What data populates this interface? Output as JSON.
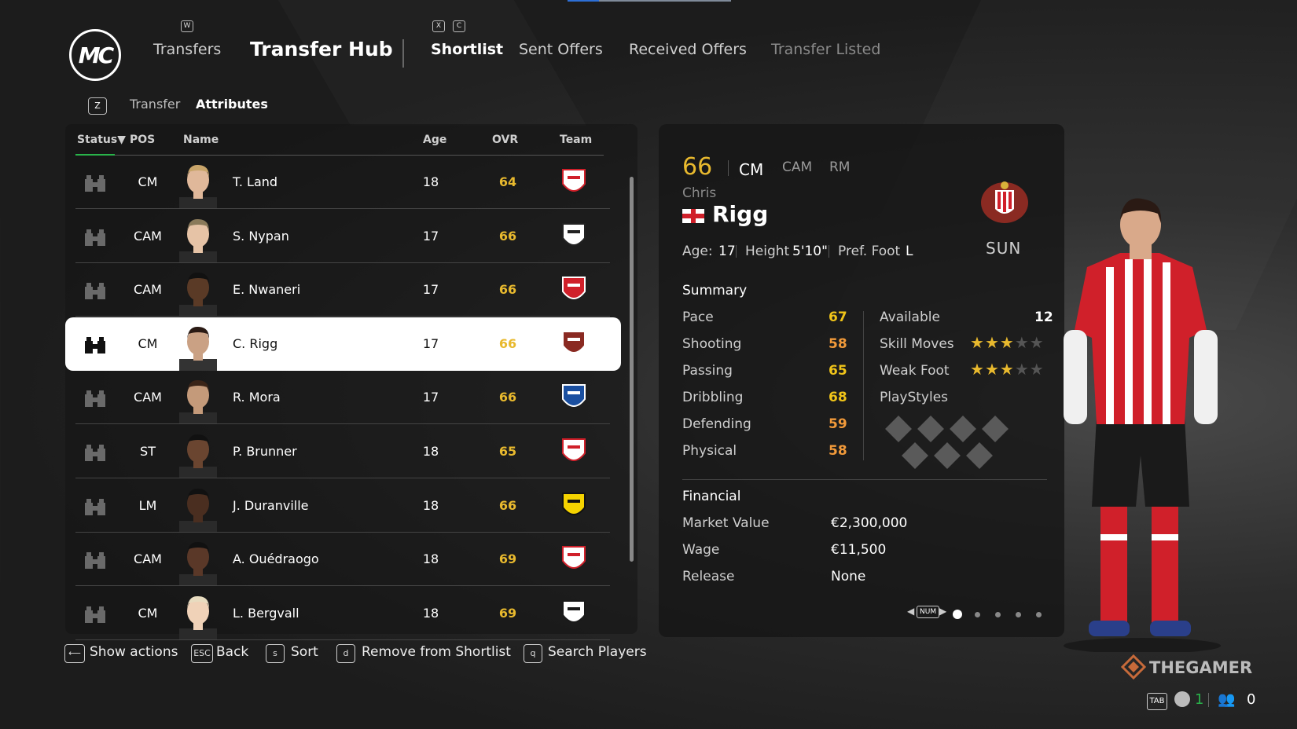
{
  "header": {
    "logo_text": "MC",
    "key_w": "W",
    "key_x": "X",
    "key_c": "C",
    "nav_transfers": "Transfers",
    "nav_hub": "Transfer Hub",
    "tab_shortlist": "Shortlist",
    "tab_sent": "Sent Offers",
    "tab_received": "Received Offers",
    "tab_listed": "Transfer Listed"
  },
  "subnav": {
    "key": "Z",
    "transfer": "Transfer",
    "attributes": "Attributes"
  },
  "table": {
    "columns": {
      "status": "Status▼",
      "pos": "POS",
      "name": "Name",
      "age": "Age",
      "ovr": "OVR",
      "team": "Team"
    },
    "rows": [
      {
        "pos": "CM",
        "name": "T. Land",
        "age": "18",
        "ovr": "64",
        "team_icon": "psv-crest"
      },
      {
        "pos": "CAM",
        "name": "S. Nypan",
        "age": "17",
        "ovr": "66",
        "team_icon": "rosenborg-crest"
      },
      {
        "pos": "CAM",
        "name": "E. Nwaneri",
        "age": "17",
        "ovr": "66",
        "team_icon": "arsenal-crest"
      },
      {
        "pos": "CM",
        "name": "C. Rigg",
        "age": "17",
        "ovr": "66",
        "team_icon": "sunderland-crest",
        "selected": true
      },
      {
        "pos": "CAM",
        "name": "R. Mora",
        "age": "17",
        "ovr": "66",
        "team_icon": "porto-crest"
      },
      {
        "pos": "ST",
        "name": "P. Brunner",
        "age": "18",
        "ovr": "65",
        "team_icon": "monaco-crest"
      },
      {
        "pos": "LM",
        "name": "J. Duranville",
        "age": "18",
        "ovr": "66",
        "team_icon": "bvb-crest"
      },
      {
        "pos": "CAM",
        "name": "A. Ouédraogo",
        "age": "18",
        "ovr": "69",
        "team_icon": "leipzig-crest"
      },
      {
        "pos": "CM",
        "name": "L. Bergvall",
        "age": "18",
        "ovr": "69",
        "team_icon": "tottenham-crest"
      }
    ]
  },
  "detail": {
    "ovr": "66",
    "positions": [
      "CM",
      "CAM",
      "RM"
    ],
    "first_name": "Chris",
    "last_name": "Rigg",
    "age_label": "Age:",
    "age": "17",
    "height_label": "Height",
    "height": "5'10\"",
    "foot_label": "Pref. Foot",
    "foot": "L",
    "club": "SUN",
    "summary_title": "Summary",
    "stats": [
      {
        "label": "Pace",
        "value": "67"
      },
      {
        "label": "Shooting",
        "value": "58"
      },
      {
        "label": "Passing",
        "value": "65"
      },
      {
        "label": "Dribbling",
        "value": "68"
      },
      {
        "label": "Defending",
        "value": "59"
      },
      {
        "label": "Physical",
        "value": "58"
      }
    ],
    "available_label": "Available",
    "available": "12",
    "skill_label": "Skill Moves",
    "skill_stars": 3,
    "weak_label": "Weak Foot",
    "weak_stars": 3,
    "playstyles_label": "PlayStyles",
    "financial_title": "Financial",
    "market_label": "Market Value",
    "market_value": "€2,300,000",
    "wage_label": "Wage",
    "wage": "€11,500",
    "release_label": "Release",
    "release": "None",
    "pager_key": "NUM",
    "pages": 5,
    "current_page": 1
  },
  "hints": {
    "show_key": "⟵",
    "show": "Show actions",
    "back_key": "ESC",
    "back": "Back",
    "sort_key": "s",
    "sort": "Sort",
    "remove_key": "d",
    "remove": "Remove from Shortlist",
    "search_key": "q",
    "search": "Search Players"
  },
  "footer": {
    "watermark": "THEGAMER",
    "tab_key": "TAB",
    "count_a": "1",
    "count_b": "0"
  },
  "colors": {
    "ovr_gold": "#e8b92e",
    "stat_yellow": "#f0c419",
    "stat_orange": "#f29a3a",
    "accent_green": "#29b34a"
  }
}
